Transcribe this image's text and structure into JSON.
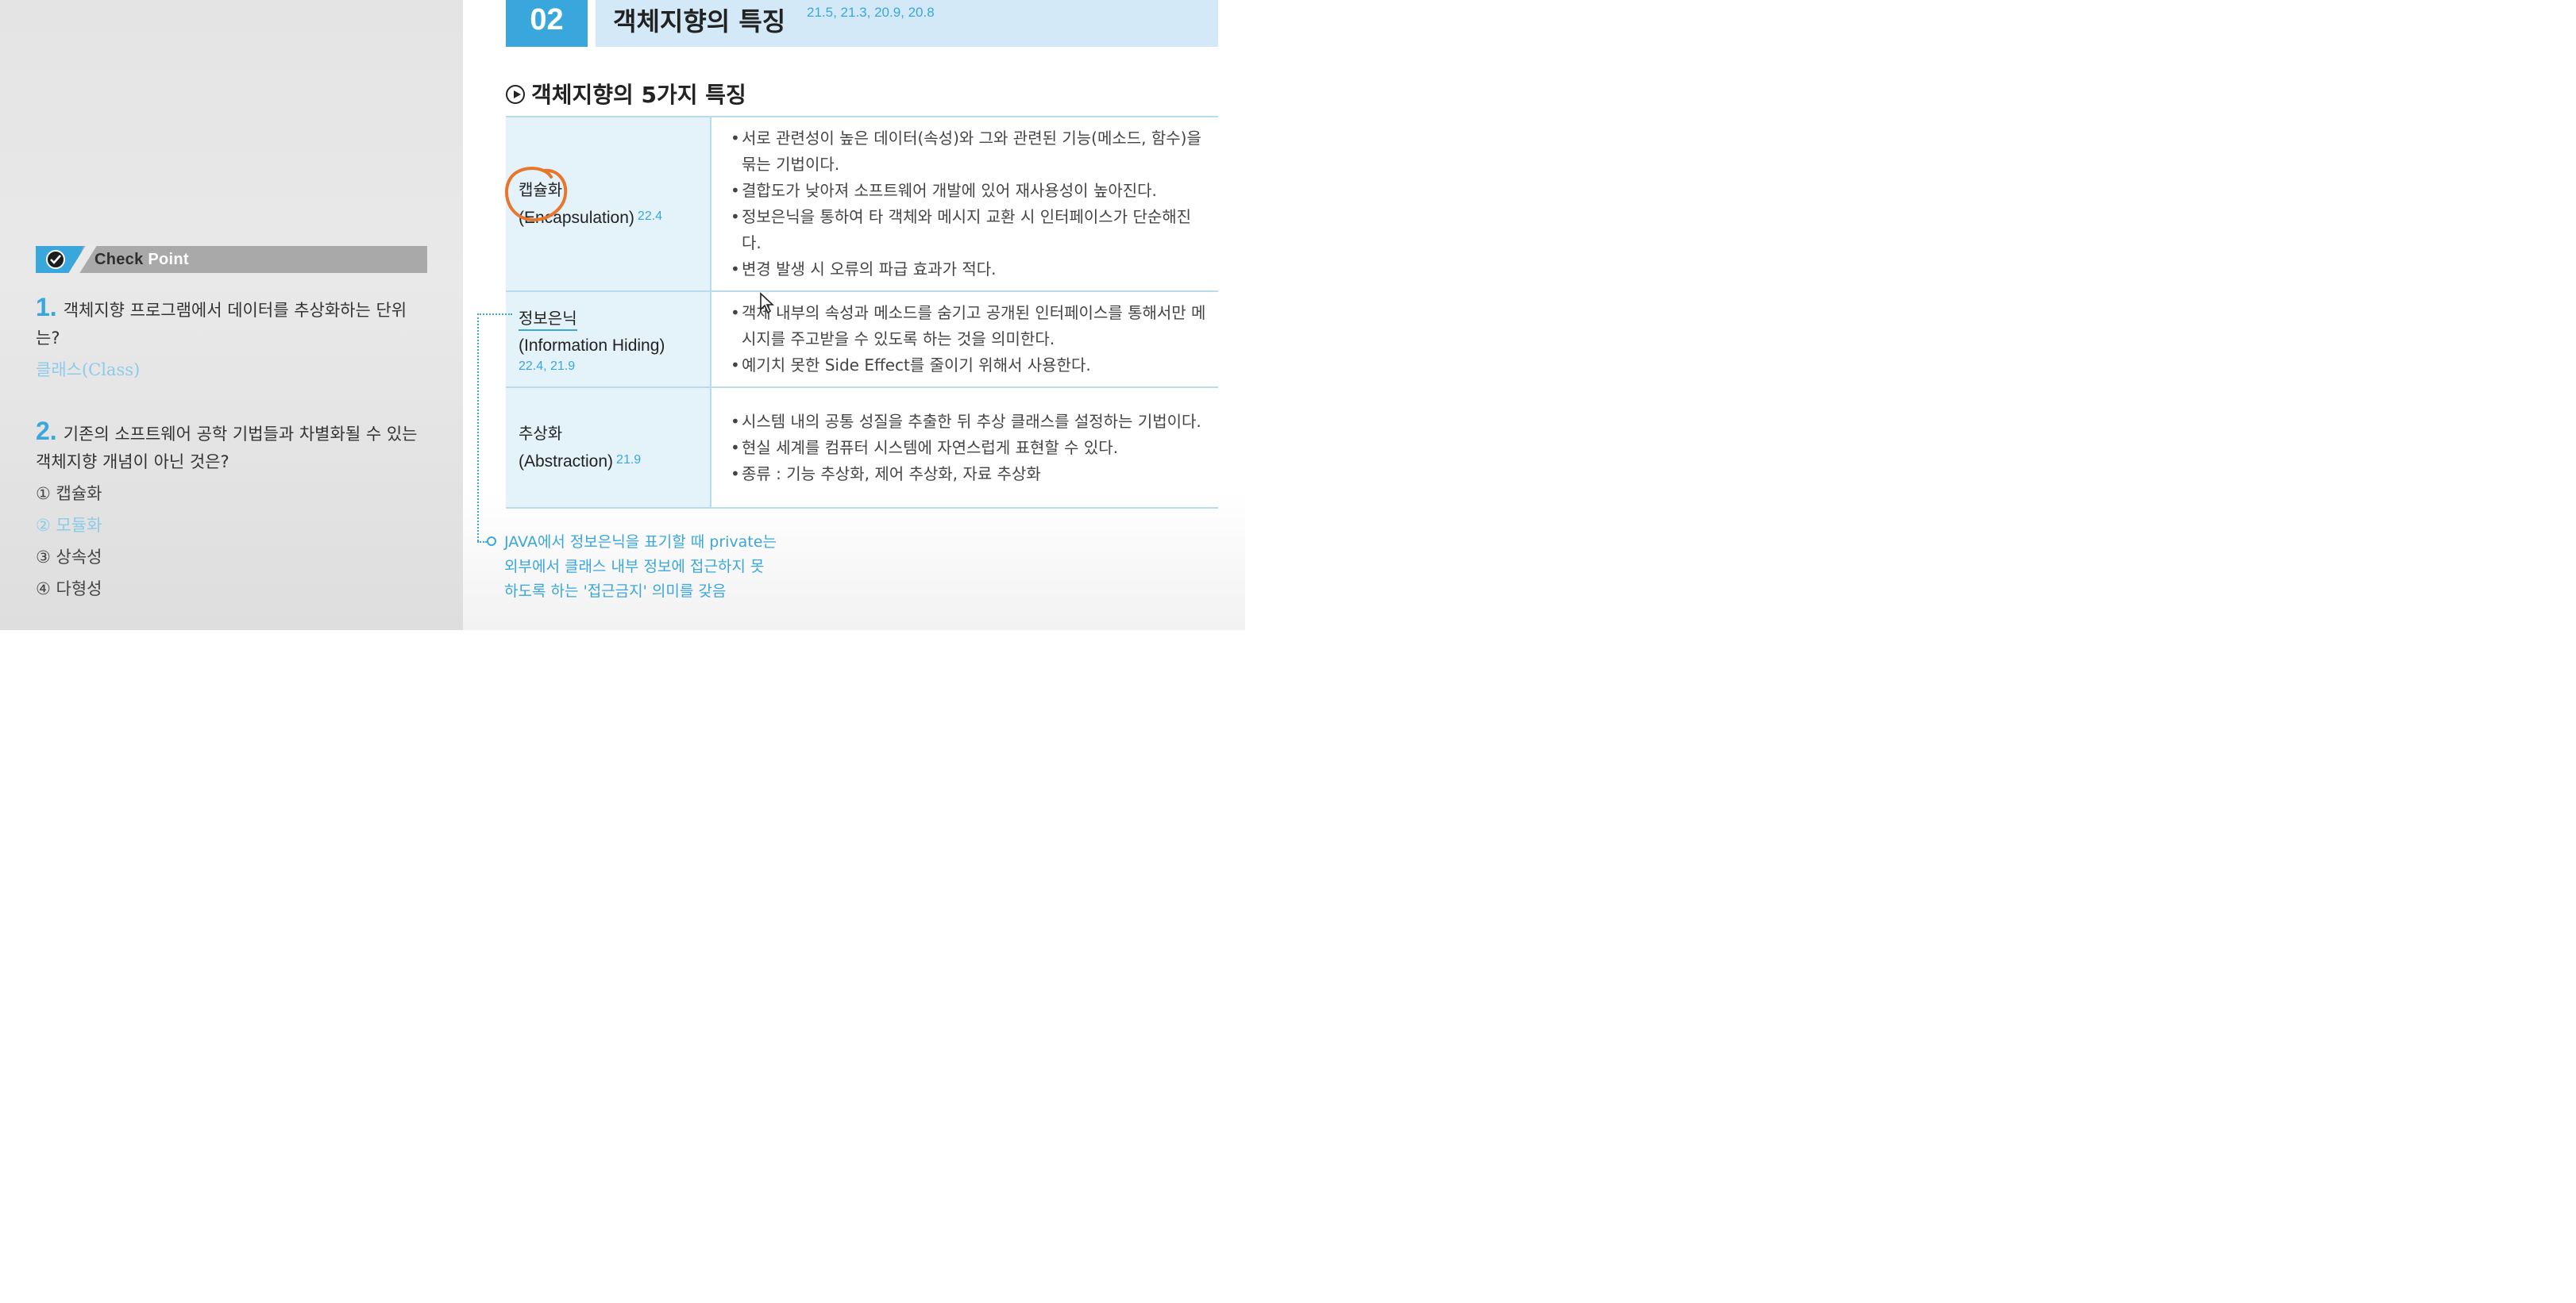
{
  "left": {
    "checkpoint": {
      "title_a": "Check",
      "title_b": "Point"
    },
    "questions": [
      {
        "number": "1.",
        "text": "객체지향 프로그램에서 데이터를 추상화하는 단위는?",
        "answer": "클래스(Class)"
      },
      {
        "number": "2.",
        "text": "기존의 소프트웨어 공학 기법들과 차별화될 수 있는 객체지향 개념이 아닌 것은?",
        "options": [
          "① 캡슐화",
          "② 모듈화",
          "③ 상속성",
          "④ 다형성"
        ]
      }
    ]
  },
  "section": {
    "number": "02",
    "title": "객체지향의 특징",
    "years": "21.5, 21.3, 20.9, 20.8",
    "subheading": "객체지향의 5가지 특징"
  },
  "table": [
    {
      "name_ko": "캡슐화",
      "name_en": "(Encapsulation)",
      "years": "22.4",
      "bullets": [
        "서로 관련성이 높은 데이터(속성)와 그와 관련된 기능(메소드, 함수)을 묶는 기법이다.",
        "결합도가 낮아져 소프트웨어 개발에 있어 재사용성이 높아진다.",
        "정보은닉을 통하여 타 객체와 메시지 교환 시 인터페이스가 단순해진다.",
        "변경 발생 시 오류의 파급 효과가 적다."
      ]
    },
    {
      "name_ko": "정보은닉",
      "name_en": "(Information Hiding)",
      "years": "22.4, 21.9",
      "bullets": [
        "객체 내부의 속성과 메소드를 숨기고 공개된 인터페이스를 통해서만 메시지를 주고받을 수 있도록 하는 것을 의미한다.",
        "예기치 못한 Side Effect를 줄이기 위해서 사용한다."
      ]
    },
    {
      "name_ko": "추상화",
      "name_en": "(Abstraction)",
      "years": "21.9",
      "bullets": [
        "시스템 내의 공통 성질을 추출한 뒤 추상 클래스를 설정하는 기법이다.",
        "현실 세계를 컴퓨터 시스템에 자연스럽게 표현할 수 있다.",
        "종류 : 기능 추상화, 제어 추상화, 자료 추상화"
      ]
    }
  ],
  "note": {
    "lines": [
      "JAVA에서 정보은닉을 표기할 때 private는",
      "외부에서 클래스 내부 정보에 접근하지 못",
      "하도록 하는 '접근금지' 의미를 갖음"
    ]
  },
  "colors": {
    "accent": "#3aa7dc",
    "annotation": "#e8772e",
    "header_bg": "#d3e9f7",
    "name_cell_bg": "#e4f2fa"
  }
}
